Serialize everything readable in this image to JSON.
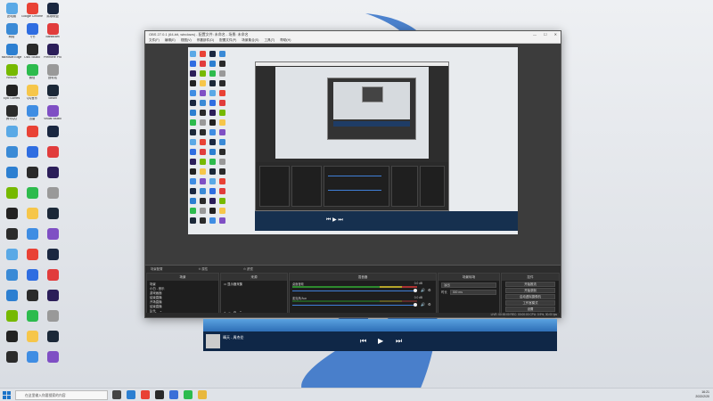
{
  "desktop": {
    "icons": [
      {
        "label": "此电脑",
        "color": "#5aa9e6"
      },
      {
        "label": "Google Chrome",
        "color": "#e94235"
      },
      {
        "label": "英雄联盟",
        "color": "#1a2740"
      },
      {
        "label": "网络",
        "color": "#3a8ad6"
      },
      {
        "label": "飞书",
        "color": "#2f6de1"
      },
      {
        "label": "Bandicam",
        "color": "#e13c3c"
      },
      {
        "label": "Microsoft Edge",
        "color": "#2c7fd1"
      },
      {
        "label": "OBS Studio",
        "color": "#2a2a2a"
      },
      {
        "label": "Premiere Pro",
        "color": "#2b1e59"
      },
      {
        "label": "NVIDIA",
        "color": "#76b900"
      },
      {
        "label": "微信",
        "color": "#2dbb4d"
      },
      {
        "label": "回收站",
        "color": "#999999"
      },
      {
        "label": "Epic Games",
        "color": "#222222"
      },
      {
        "label": "QQ音乐",
        "color": "#f6c64a"
      },
      {
        "label": "Steam",
        "color": "#1b2838"
      },
      {
        "label": "腾讯QQ",
        "color": "#2b2b2b"
      },
      {
        "label": "迅雷",
        "color": "#3f8de3"
      },
      {
        "label": "Visual Studio",
        "color": "#7f4fc4"
      }
    ]
  },
  "obs": {
    "title": "OBS 27.0.1 (64-bit, windows) - 配置文件: 未命名 - 场景: 未命名",
    "menu": [
      "文件(F)",
      "编辑(E)",
      "视图(V)",
      "停靠部件(D)",
      "配置文件(P)",
      "场景集合(S)",
      "工具(T)",
      "帮助(H)"
    ],
    "scene_bar": [
      "场景配置",
      "⊙ 属性",
      "⊙ 滤镜"
    ],
    "docks": {
      "scenes": {
        "title": "场景",
        "items": [
          "场景",
          "小白 - 音乐",
          "游戏画面",
          "结束直播",
          "开场直播",
          "结束直播",
          "片头",
          "以播放中..."
        ]
      },
      "sources": {
        "title": "来源",
        "items": [
          "显示器采集"
        ]
      },
      "mixer": {
        "title": "混音器",
        "tracks": [
          {
            "name": "桌面音频",
            "level": "0.0 dB"
          },
          {
            "name": "麦克风/Aux",
            "level": "0.0 dB"
          }
        ]
      },
      "transitions": {
        "title": "场景转场",
        "type": "淡出",
        "duration_label": "时长",
        "duration": "300 ms"
      },
      "controls": {
        "title": "控件",
        "buttons": [
          "开始推流",
          "开始录制",
          "启动虚拟摄像机",
          "工作室模式",
          "设置",
          "退出"
        ]
      }
    },
    "status": "LIVE: 00:00:00   REC: 00:00:00   CPU: 0.9%, 30.00 fps"
  },
  "music": {
    "song": "晴天 - 周杰伦",
    "controls": [
      "⏮",
      "▶",
      "⏭"
    ]
  },
  "taskbar": {
    "search_placeholder": "在这里输入你要搜索的内容",
    "time": "16:21",
    "date": "2022/2/20",
    "apps": [
      {
        "name": "task-view",
        "color": "#444444"
      },
      {
        "name": "edge",
        "color": "#2c7fd1"
      },
      {
        "name": "chrome",
        "color": "#e94235"
      },
      {
        "name": "obs",
        "color": "#2a2a2a"
      },
      {
        "name": "netease",
        "color": "#3a6fd8"
      },
      {
        "name": "wechat",
        "color": "#2dbb4d"
      },
      {
        "name": "folder",
        "color": "#e8b83e"
      }
    ]
  }
}
